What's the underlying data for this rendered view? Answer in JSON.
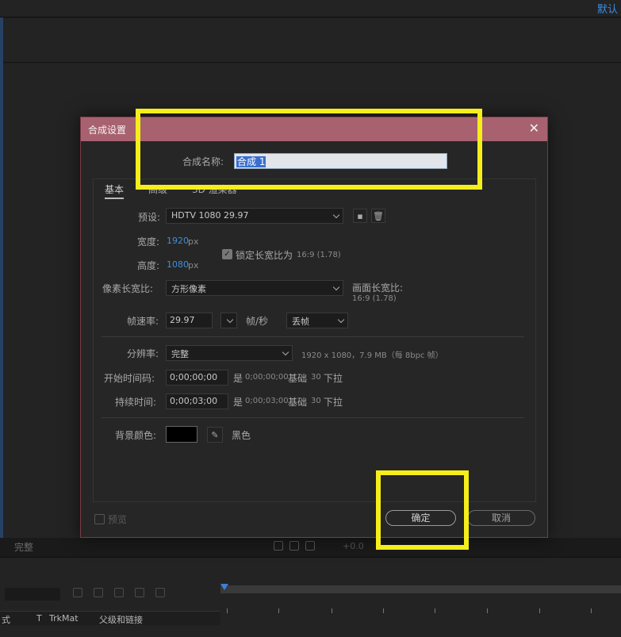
{
  "app": {
    "workspace_label": "默认",
    "viewer_resolution": "完整",
    "viewer_exposure": "+0.0",
    "timeline_columns": {
      "mode_col": "式",
      "t_col": "T",
      "trkmat_col": "TrkMat",
      "parent_col": "父级和链接"
    }
  },
  "dialog": {
    "title": "合成设置",
    "close_glyph": "✕",
    "comp_name_label": "合成名称:",
    "comp_name_value": "合成 1",
    "tabs": [
      {
        "label": "基本"
      },
      {
        "label": "高级"
      },
      {
        "label": "3D 渲染器"
      }
    ],
    "preset_label": "预设:",
    "preset_value": "HDTV 1080 29.97",
    "width_label": "宽度:",
    "width_value": "1920",
    "width_unit": "px",
    "height_label": "高度:",
    "height_value": "1080",
    "height_unit": "px",
    "lock_aspect_label": "锁定长宽比为",
    "lock_aspect_value": "16:9 (1.78)",
    "pixel_aspect_label": "像素长宽比:",
    "pixel_aspect_value": "方形像素",
    "frame_aspect_label": "画面长宽比:",
    "frame_aspect_value": "16:9 (1.78)",
    "frame_rate_label": "帧速率:",
    "frame_rate_value": "29.97",
    "frame_rate_unit": "帧/秒",
    "drop_frame_value": "丢帧",
    "resolution_label": "分辨率:",
    "resolution_value": "完整",
    "resolution_info": "1920 x 1080，7.9 MB（每 8bpc 帧）",
    "start_tc_label": "开始时间码:",
    "start_tc_value": "0;00;00;00",
    "start_tc_info": {
      "prefix": "是",
      "tc": "0;00;00;00",
      "base_label": "基础",
      "base_value": "30",
      "pulldown": "下拉"
    },
    "duration_label": "持续时间:",
    "duration_value": "0;00;03;00",
    "duration_info": {
      "prefix": "是",
      "tc": "0;00;03;00",
      "base_label": "基础",
      "base_value": "30",
      "pulldown": "下拉"
    },
    "bg_color_label": "背景颜色:",
    "bg_color_hex": "#000000",
    "bg_color_name": "黑色",
    "preview_label": "预览",
    "ok_label": "确定",
    "cancel_label": "取消"
  },
  "colors": {
    "title_bar": "#a8626f",
    "highlight": "#f5ee1b",
    "value_blue": "#3f8ed8",
    "selection": "#3a6fd0"
  }
}
